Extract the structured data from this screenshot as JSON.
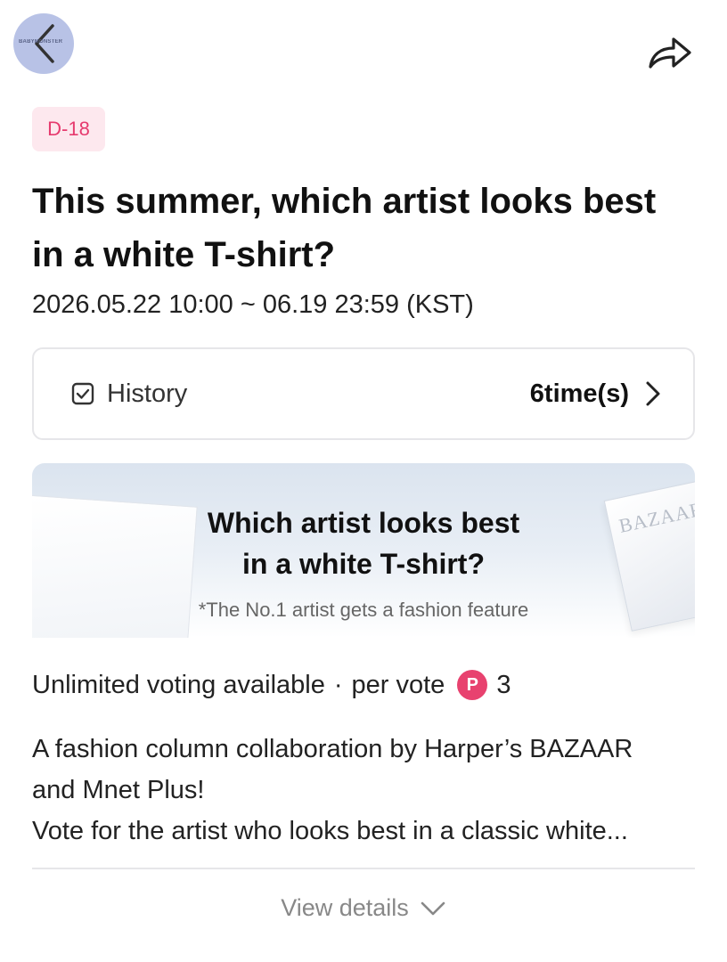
{
  "header": {
    "back_logo_text": "BABYMONSTER",
    "back_icon": "chevron-left-icon",
    "share_icon": "share-arrow-icon"
  },
  "badge": {
    "dday": "D-18"
  },
  "vote": {
    "title": "This summer, which artist looks best in a white T-shirt?",
    "period": "2026.05.22 10:00 ~ 06.19 23:59 (KST)"
  },
  "history": {
    "label": "History",
    "count": "6time(s)",
    "icon": "checkbox-icon"
  },
  "banner": {
    "title_line1": "Which artist looks best",
    "title_line2": "in a white T-shirt?",
    "note": "*The No.1 artist gets a fashion feature",
    "magazine_text": "BAZAAR"
  },
  "voting": {
    "unlimited": "Unlimited voting available",
    "per_vote": "per vote",
    "point_badge": "P",
    "cost": "3"
  },
  "description": {
    "line1": "A fashion column collaboration by Harper’s BAZAAR",
    "line2": "and Mnet Plus!",
    "line3": "Vote for the artist who looks best in a classic white..."
  },
  "footer": {
    "view_details": "View details"
  },
  "colors": {
    "accent_pink": "#e8426f",
    "badge_bg": "#fde8ee",
    "back_button_bg": "#b8c2e6"
  }
}
